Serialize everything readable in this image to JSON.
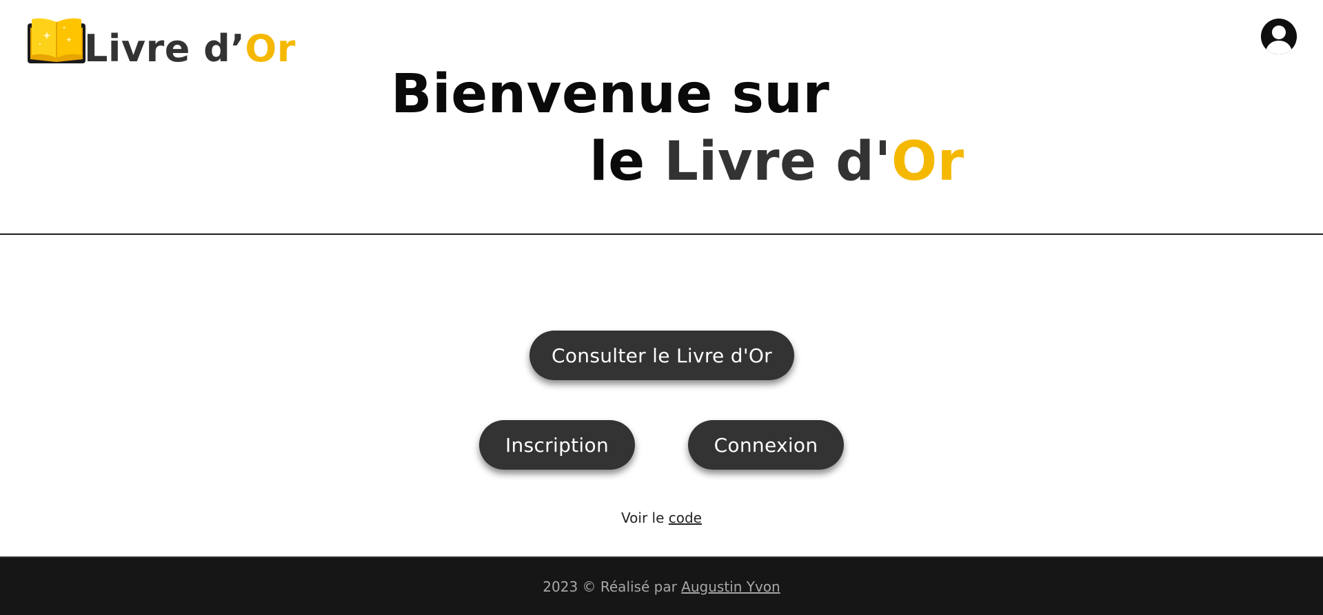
{
  "header": {
    "logo": {
      "text_prefix": "Livre d’",
      "text_accent": "Or",
      "icon": "open-book-icon"
    },
    "user_icon": "user-account-icon",
    "hero": {
      "line1": "Bienvenue sur",
      "line2_prefix": "le",
      "line2_main": "Livre d'",
      "line2_accent": "Or"
    }
  },
  "main": {
    "consult_label": "Consulter le Livre d'Or",
    "inscription_label": "Inscription",
    "connexion_label": "Connexion",
    "code_prefix": "Voir le",
    "code_link": "code"
  },
  "footer": {
    "text": "2023 © Réalisé par",
    "author": "Augustin Yvon"
  },
  "colors": {
    "accent_gold": "#f5b800",
    "button_dark": "#333333",
    "footer_bg": "#161616",
    "footer_text": "#a8a8a8"
  }
}
